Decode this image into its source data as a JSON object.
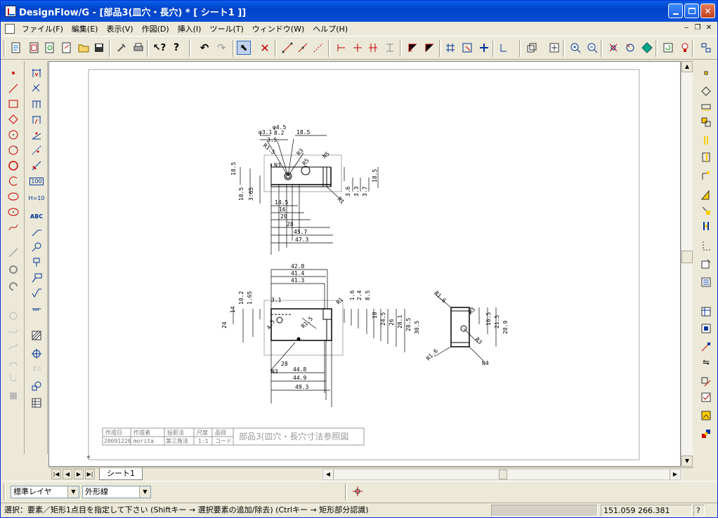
{
  "window": {
    "title": "DesignFlow/G - [部品3(皿穴・長穴) * [ シート1 ]]"
  },
  "menu": {
    "items": [
      "ファイル(F)",
      "編集(E)",
      "表示(V)",
      "作図(D)",
      "挿入(I)",
      "ツール(T)",
      "ウィンドウ(W)",
      "ヘルプ(H)"
    ]
  },
  "tabs": {
    "active": "シート1"
  },
  "layer": {
    "layer_value": "標準レイヤ",
    "linetype_value": "外形線"
  },
  "status": {
    "message": "選択：要素／矩形1点目を指定して下さい (Shiftキー → 選択要素の追加/除去) (Ctrlキー → 矩形部分認識)",
    "coords": "151.059 266.381",
    "help": "?"
  },
  "titleblock": {
    "headers": [
      "作成日",
      "作成者",
      "投影法",
      "尺度",
      "品目"
    ],
    "values": [
      "20091226",
      "morita",
      "第三角法",
      "1:1",
      "コード"
    ],
    "name": "部品3(皿穴・長穴寸法参照図"
  },
  "drawing": {
    "top_view_dims": [
      "φ4.5",
      "φ3.1",
      "8.2",
      "18.5",
      "3.5",
      "18.5",
      "10.5",
      "3.65",
      "14.5",
      "16",
      "20",
      "28",
      "45.7",
      "47.3",
      "3.6",
      "3.3",
      "3.7",
      "18.5",
      "R1",
      "R3",
      "R5",
      "R1.5",
      "N5",
      "N3"
    ],
    "front_view_dims": [
      "42.8",
      "41.4",
      "41.3",
      "10.2",
      "1.65",
      "3.1",
      "14",
      "24",
      "1.6",
      "2.4",
      "8.5",
      "10",
      "24.5",
      "26",
      "28.1",
      "28.5",
      "30.5",
      "28",
      "44.8",
      "44.9",
      "49.3",
      "R1.5",
      "R1",
      "N3",
      "4.5"
    ],
    "side_view_dims": [
      "R1.6",
      "R3",
      "16.5",
      "21.5",
      "28.9",
      "R3",
      "R1.6",
      "N4"
    ]
  },
  "colors": {
    "title_bar": "#0a5fe8",
    "chrome": "#ece9d8",
    "accent_red": "#cc0000",
    "paper_border": "#999999"
  }
}
